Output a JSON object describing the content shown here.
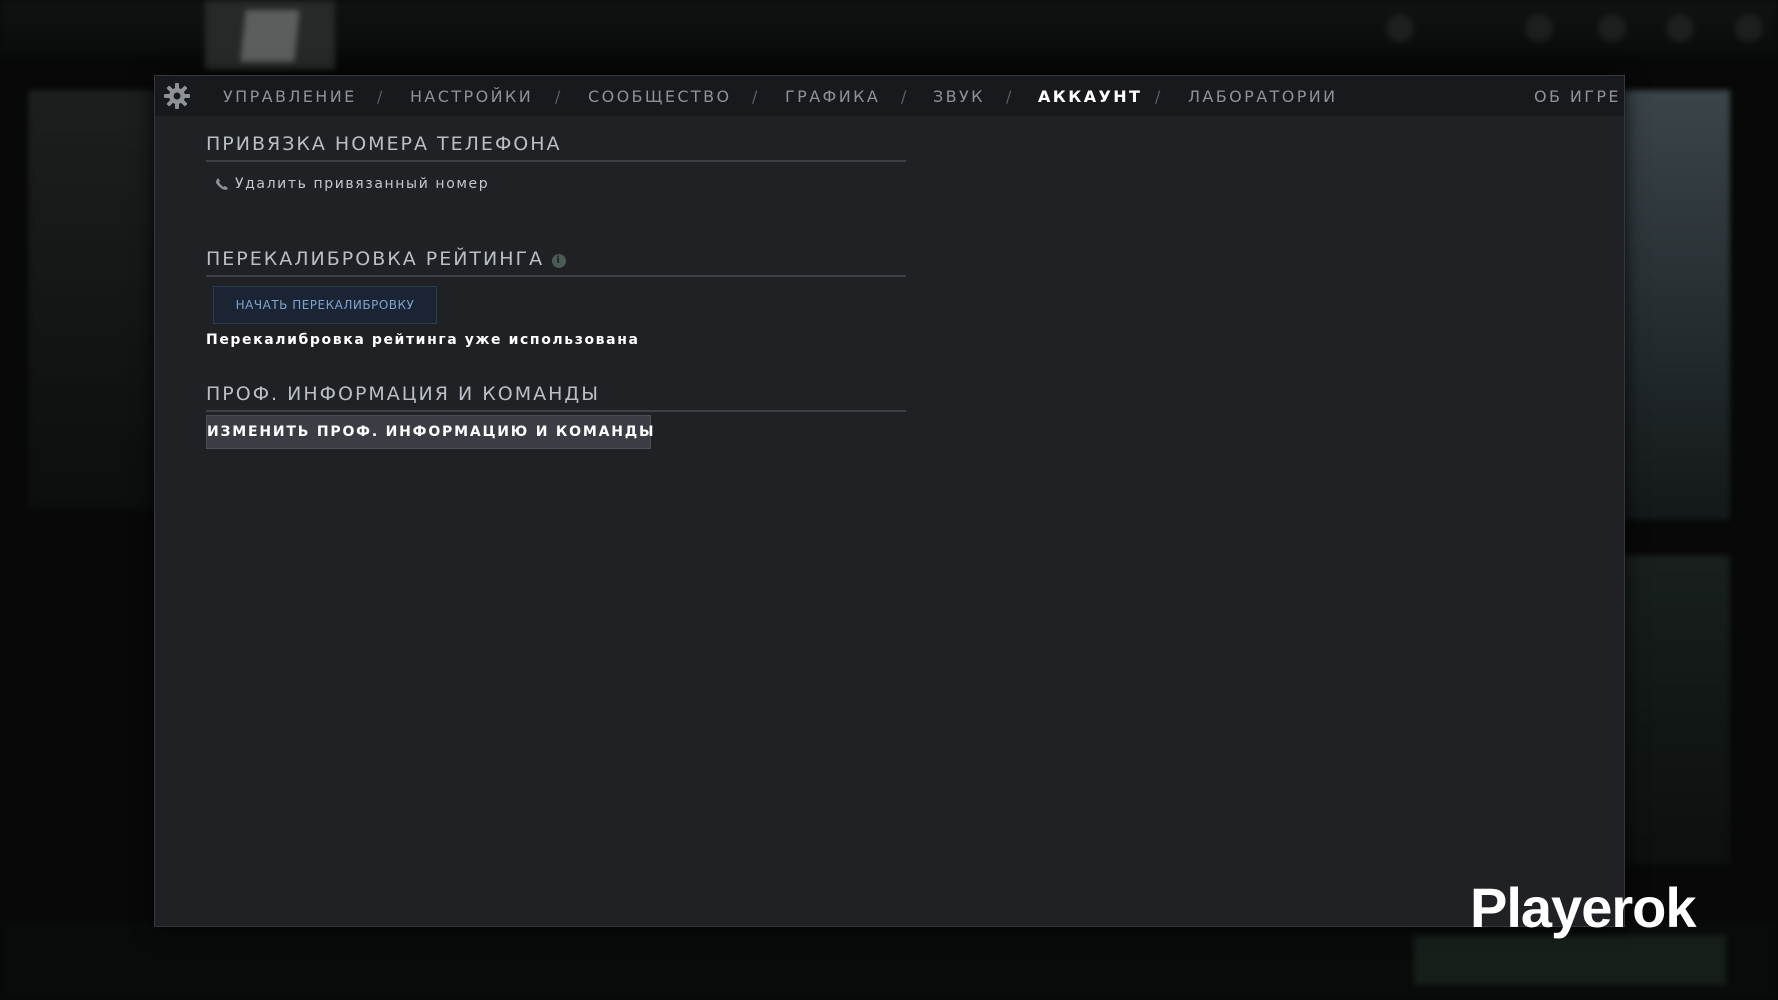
{
  "tabs": [
    {
      "label": "УПРАВЛЕНИЕ",
      "active": false
    },
    {
      "label": "НАСТРОЙКИ",
      "active": false
    },
    {
      "label": "СООБЩЕСТВО",
      "active": false
    },
    {
      "label": "ГРАФИКА",
      "active": false
    },
    {
      "label": "ЗВУК",
      "active": false
    },
    {
      "label": "АККАУНТ",
      "active": true
    },
    {
      "label": "ЛАБОРАТОРИИ",
      "active": false
    }
  ],
  "tab_separator": "/",
  "about_tab": "ОБ ИГРЕ",
  "phone": {
    "title": "ПРИВЯЗКА НОМЕРА ТЕЛЕФОНА",
    "remove_label": "Удалить привязанный номер"
  },
  "recalibration": {
    "title": "ПЕРЕКАЛИБРОВКА РЕЙТИНГА",
    "button_label": "НАЧАТЬ ПЕРЕКАЛИБРОВКУ",
    "note": "Перекалибровка рейтинга уже использована"
  },
  "pro_info": {
    "title": "ПРОФ. ИНФОРМАЦИЯ И КОМАНДЫ",
    "button_label": "ИЗМЕНИТЬ ПРОФ. ИНФОРМАЦИЮ И КОМАНДЫ"
  },
  "watermark": "Playerok",
  "icons": {
    "settings": "gear-icon",
    "phone": "phone-icon",
    "info": "info-icon"
  },
  "colors": {
    "window_bg": "#1f2125",
    "active_tab": "#ffffff",
    "inactive_tab": "#8d9298",
    "recal_button_text": "#7ea3d1"
  }
}
